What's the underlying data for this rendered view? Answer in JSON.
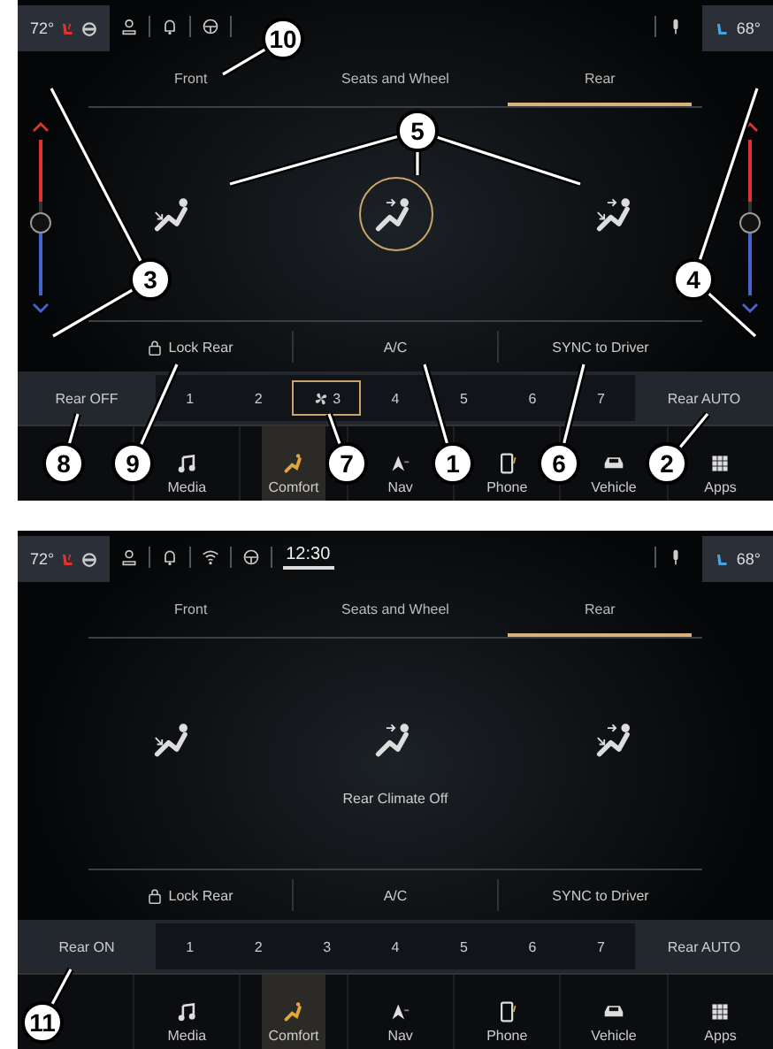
{
  "screens": [
    {
      "status_bar": {
        "left_temp": "72°",
        "icons": [
          {
            "kind": "person"
          },
          {
            "kind": "bell"
          },
          {
            "kind": "steering"
          }
        ],
        "right_temp": "68°"
      },
      "tabs": [
        {
          "label": "Front",
          "selected": false
        },
        {
          "label": "Seats and Wheel",
          "selected": false
        },
        {
          "label": "Rear",
          "selected": true
        }
      ],
      "temp_sliders": [
        {
          "level": 0.47
        },
        {
          "level": 0.47
        }
      ],
      "vents": [
        {
          "kind": "lower",
          "selected": false
        },
        {
          "kind": "upper",
          "selected": true
        },
        {
          "kind": "both",
          "selected": false
        }
      ],
      "options": [
        {
          "label": "Lock Rear",
          "kind": "lock"
        },
        {
          "label": "A/C",
          "kind": "text"
        },
        {
          "label": "SYNC to Driver",
          "kind": "text"
        }
      ],
      "power_button": "Rear OFF",
      "fan_levels": [
        {
          "label": "1",
          "selected": false
        },
        {
          "label": "2",
          "selected": false
        },
        {
          "label": "3",
          "selected": true
        },
        {
          "label": "4",
          "selected": false
        },
        {
          "label": "5",
          "selected": false
        },
        {
          "label": "6",
          "selected": false
        },
        {
          "label": "7",
          "selected": false
        }
      ],
      "auto_button": "Rear AUTO",
      "nav": [
        {
          "label": "Media",
          "kind": "music",
          "selected": false
        },
        {
          "label": "Comfort",
          "kind": "seat",
          "selected": true
        },
        {
          "label": "Nav",
          "kind": "nav",
          "selected": false
        },
        {
          "label": "Phone",
          "kind": "phone",
          "selected": false
        },
        {
          "label": "Vehicle",
          "kind": "car",
          "selected": false
        },
        {
          "label": "Apps",
          "kind": "grid",
          "selected": false
        }
      ]
    },
    {
      "status_bar": {
        "left_temp": "72°",
        "icons": [
          {
            "kind": "person"
          },
          {
            "kind": "bell"
          },
          {
            "kind": "wifi"
          },
          {
            "kind": "steering"
          }
        ],
        "clock": "12:30",
        "right_temp": "68°"
      },
      "tabs": [
        {
          "label": "Front",
          "selected": false
        },
        {
          "label": "Seats and Wheel",
          "selected": false
        },
        {
          "label": "Rear",
          "selected": true
        }
      ],
      "vents": [
        {
          "kind": "lower",
          "selected": false
        },
        {
          "kind": "upper",
          "selected": false
        },
        {
          "kind": "both",
          "selected": false
        }
      ],
      "status_text": "Rear Climate Off",
      "options": [
        {
          "label": "Lock Rear",
          "kind": "lock"
        },
        {
          "label": "A/C",
          "kind": "text"
        },
        {
          "label": "SYNC to Driver",
          "kind": "text"
        }
      ],
      "power_button": "Rear ON",
      "fan_levels": [
        {
          "label": "1",
          "selected": false
        },
        {
          "label": "2",
          "selected": false
        },
        {
          "label": "3",
          "selected": false
        },
        {
          "label": "4",
          "selected": false
        },
        {
          "label": "5",
          "selected": false
        },
        {
          "label": "6",
          "selected": false
        },
        {
          "label": "7",
          "selected": false
        }
      ],
      "auto_button": "Rear AUTO",
      "nav": [
        {
          "label": "Media",
          "kind": "music",
          "selected": false
        },
        {
          "label": "Comfort",
          "kind": "seat",
          "selected": true
        },
        {
          "label": "Nav",
          "kind": "nav",
          "selected": false
        },
        {
          "label": "Phone",
          "kind": "phone",
          "selected": false
        },
        {
          "label": "Vehicle",
          "kind": "car",
          "selected": false
        },
        {
          "label": "Apps",
          "kind": "grid",
          "selected": false
        }
      ]
    }
  ],
  "callouts": [
    {
      "label": "10"
    },
    {
      "label": "5"
    },
    {
      "label": "3"
    },
    {
      "label": "4"
    },
    {
      "label": "8"
    },
    {
      "label": "9"
    },
    {
      "label": "7"
    },
    {
      "label": "1"
    },
    {
      "label": "6"
    },
    {
      "label": "2"
    },
    {
      "label": "11"
    }
  ]
}
